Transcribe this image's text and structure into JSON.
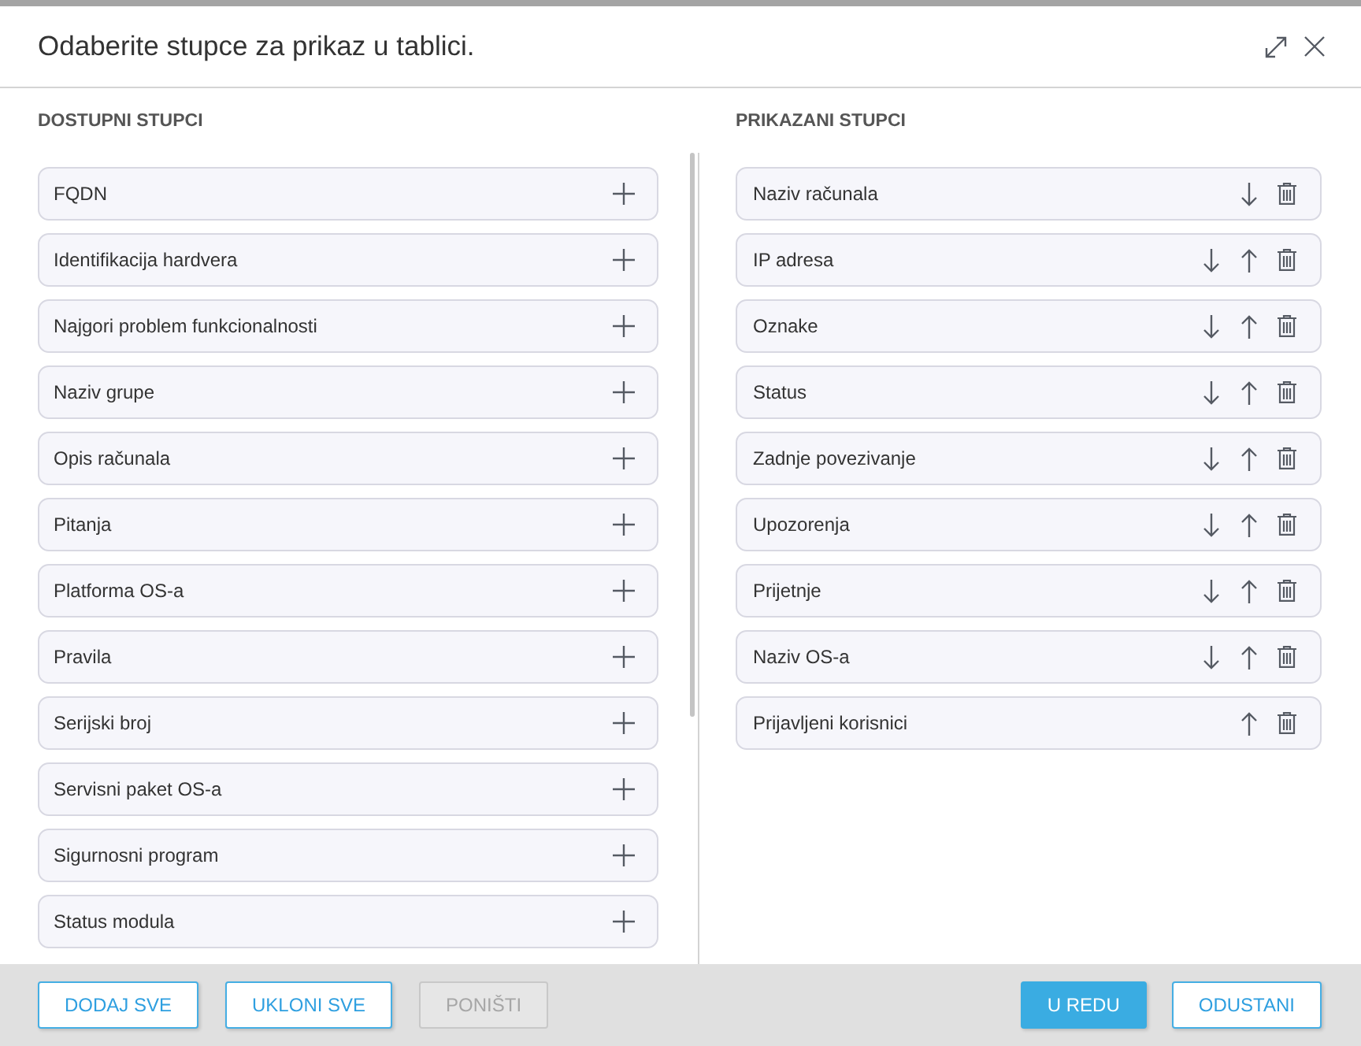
{
  "dialog": {
    "title": "Odaberite stupce za prikaz u tablici."
  },
  "available": {
    "heading": "DOSTUPNI STUPCI",
    "items": [
      {
        "label": "FQDN"
      },
      {
        "label": "Identifikacija hardvera"
      },
      {
        "label": "Najgori problem funkcionalnosti"
      },
      {
        "label": "Naziv grupe"
      },
      {
        "label": "Opis računala"
      },
      {
        "label": "Pitanja"
      },
      {
        "label": "Platforma OS-a"
      },
      {
        "label": "Pravila"
      },
      {
        "label": "Serijski broj"
      },
      {
        "label": "Servisni paket OS-a"
      },
      {
        "label": "Sigurnosni program"
      },
      {
        "label": "Status modula"
      }
    ]
  },
  "displayed": {
    "heading": "PRIKAZANI STUPCI",
    "items": [
      {
        "label": "Naziv računala",
        "move_down": true,
        "move_up": false
      },
      {
        "label": "IP adresa",
        "move_down": true,
        "move_up": true
      },
      {
        "label": "Oznake",
        "move_down": true,
        "move_up": true
      },
      {
        "label": "Status",
        "move_down": true,
        "move_up": true
      },
      {
        "label": "Zadnje povezivanje",
        "move_down": true,
        "move_up": true
      },
      {
        "label": "Upozorenja",
        "move_down": true,
        "move_up": true
      },
      {
        "label": "Prijetnje",
        "move_down": true,
        "move_up": true
      },
      {
        "label": "Naziv OS-a",
        "move_down": true,
        "move_up": true
      },
      {
        "label": "Prijavljeni korisnici",
        "move_down": false,
        "move_up": true
      }
    ]
  },
  "footer": {
    "left_buttons": [
      {
        "label": "DODAJ SVE",
        "kind": "outline",
        "disabled": false
      },
      {
        "label": "UKLONI SVE",
        "kind": "outline",
        "disabled": false
      },
      {
        "label": "PONIŠTI",
        "kind": "outline",
        "disabled": true
      }
    ],
    "right_buttons": [
      {
        "label": "U REDU",
        "kind": "primary",
        "disabled": false
      },
      {
        "label": "ODUSTANI",
        "kind": "outline",
        "disabled": false
      }
    ]
  }
}
